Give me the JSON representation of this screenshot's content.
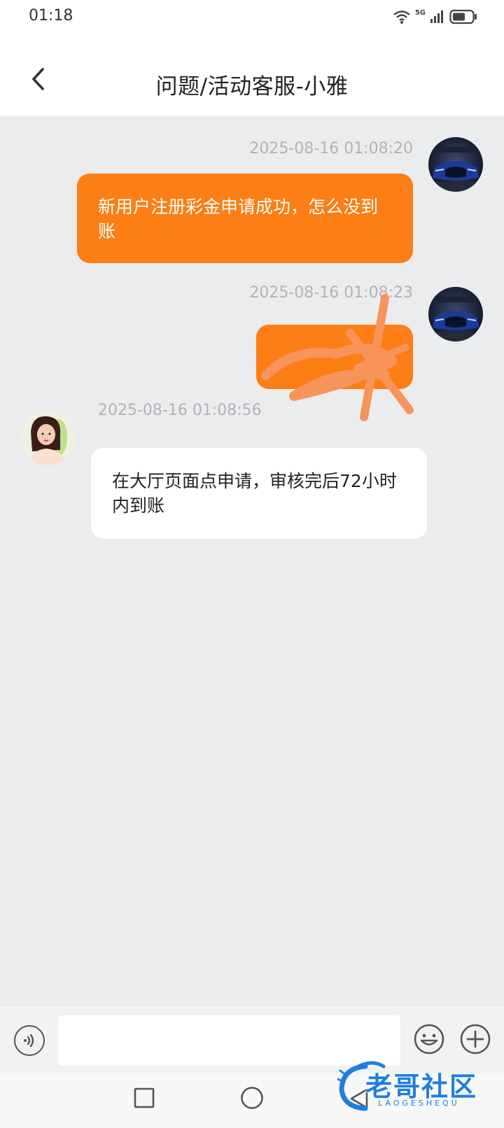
{
  "status_bar": {
    "time": "01:18",
    "network": "5G",
    "icons": [
      "wifi-icon",
      "signal-icon",
      "battery-icon"
    ]
  },
  "header": {
    "title": "问题/活动客服-小雅"
  },
  "messages": [
    {
      "direction": "outgoing",
      "timestamp": "2025-08-16 01:08:20",
      "text": "新用户注册彩金申请成功，怎么没到账"
    },
    {
      "direction": "outgoing",
      "timestamp": "2025-08-16 01:08:23",
      "text": "",
      "redacted": true
    },
    {
      "direction": "incoming",
      "timestamp": "2025-08-16 01:08:56",
      "text": "在大厅页面点申请，审核完后72小时内到账"
    }
  ],
  "input_bar": {
    "placeholder": "",
    "icons": [
      "voice-icon",
      "emoji-icon",
      "plus-icon"
    ]
  },
  "watermark": {
    "text": "老哥社区",
    "sub": "LAOGESHEQU"
  },
  "colors": {
    "accent": "#fc7e14",
    "background": "#ebecee",
    "timestamp": "#b2b3b6"
  }
}
